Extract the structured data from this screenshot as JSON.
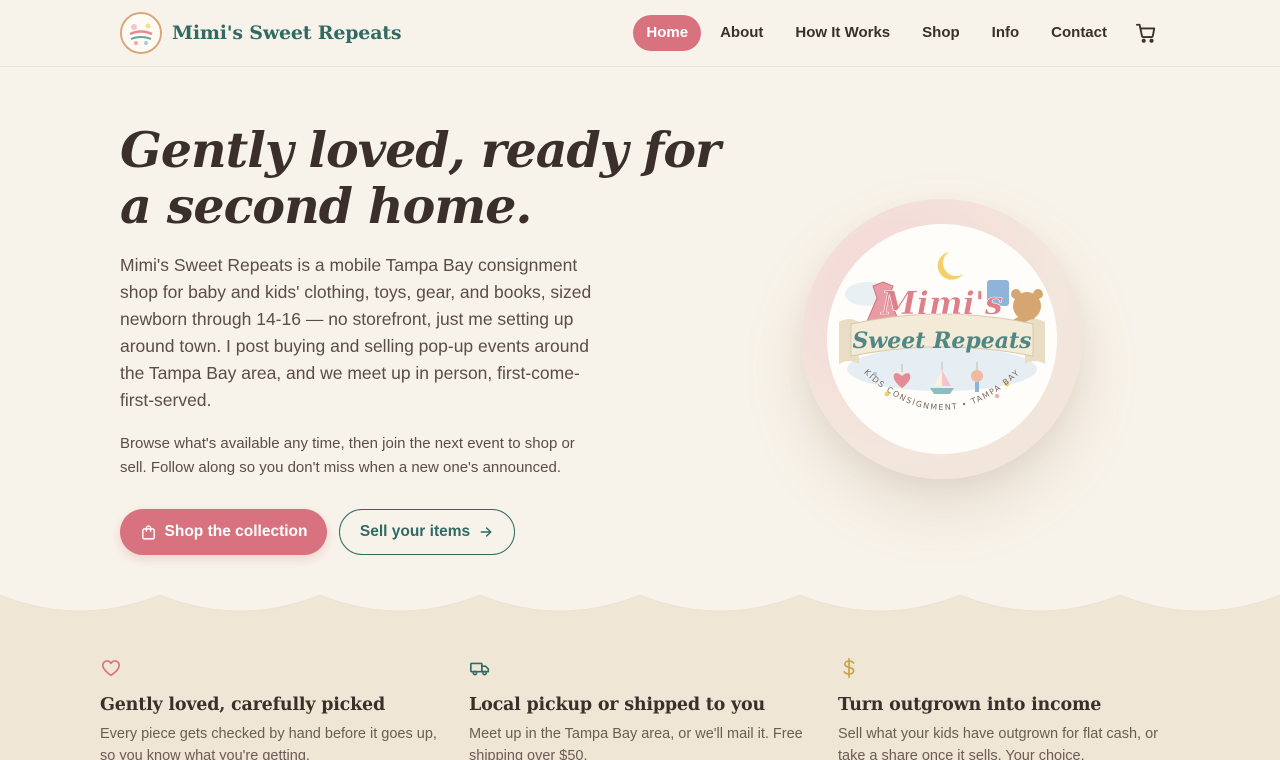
{
  "brand": {
    "name": "Mimi's Sweet Repeats",
    "logo_text": "Mimi's Sweet Repeats",
    "logo_tagline": "KIDS CONSIGNMENT • TAMPA BAY"
  },
  "nav": {
    "items": [
      {
        "label": "Home",
        "active": true
      },
      {
        "label": "About",
        "active": false
      },
      {
        "label": "How It Works",
        "active": false
      },
      {
        "label": "Shop",
        "active": false
      },
      {
        "label": "Info",
        "active": false
      },
      {
        "label": "Contact",
        "active": false
      }
    ],
    "cart_icon": "shopping-cart-icon"
  },
  "hero": {
    "title": "Gently loved, ready for a second home.",
    "body": "Mimi's Sweet Repeats is a mobile Tampa Bay consignment shop for baby and kids' clothing, toys, gear, and books, sized newborn through 14-16 — no storefront, just me setting up around town. I post buying and selling pop-up events around the Tampa Bay area, and we meet up in person, first-come-first-served.",
    "subtext": "Browse what's available any time, then join the next event to shop or sell. Follow along so you don't miss when a new one's announced.",
    "primary_button": "Shop the collection",
    "secondary_button": "Sell your items"
  },
  "features": [
    {
      "icon": "heart-icon",
      "title": "Gently loved, carefully picked",
      "text": "Every piece gets checked by hand before it goes up, so you know what you're getting."
    },
    {
      "icon": "truck-icon",
      "title": "Local pickup or shipped to you",
      "text": "Meet up in the Tampa Bay area, or we'll mail it. Free shipping over $50."
    },
    {
      "icon": "dollar-icon",
      "title": "Turn outgrown into income",
      "text": "Sell what your kids have outgrown for flat cash, or take a share once it sells. Your choice."
    }
  ],
  "colors": {
    "background": "#f8f3ea",
    "accent_pink": "#d9727f",
    "accent_teal": "#2f6b63",
    "feature_band": "#f0e6d6",
    "gold": "#c9a24a"
  }
}
